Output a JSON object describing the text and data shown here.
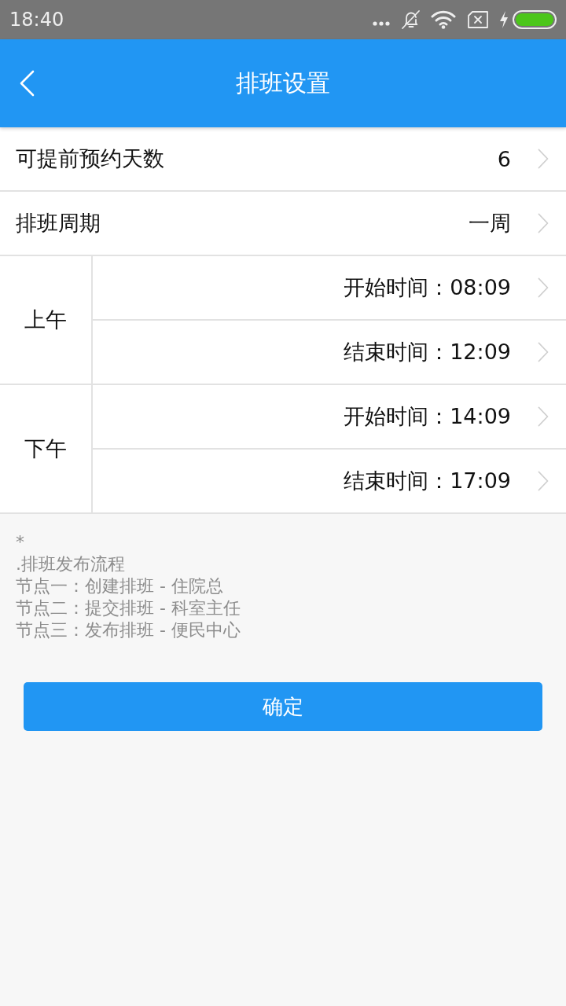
{
  "status_bar": {
    "time": "18:40"
  },
  "app_bar": {
    "title": "排班设置"
  },
  "settings": [
    {
      "label": "可提前预约天数",
      "value": "6"
    },
    {
      "label": "排班周期",
      "value": "一周"
    }
  ],
  "periods": [
    {
      "label": "上午",
      "times": [
        "开始时间：08:09",
        "结束时间：12:09"
      ]
    },
    {
      "label": "下午",
      "times": [
        "开始时间：14:09",
        "结束时间：17:09"
      ]
    }
  ],
  "notes": [
    "*",
    ".排班发布流程",
    "节点一：创建排班 - 住院总",
    "节点二：提交排班 - 科室主任",
    "节点三：发布排班 - 便民中心"
  ],
  "confirm_button": {
    "label": "确定"
  }
}
